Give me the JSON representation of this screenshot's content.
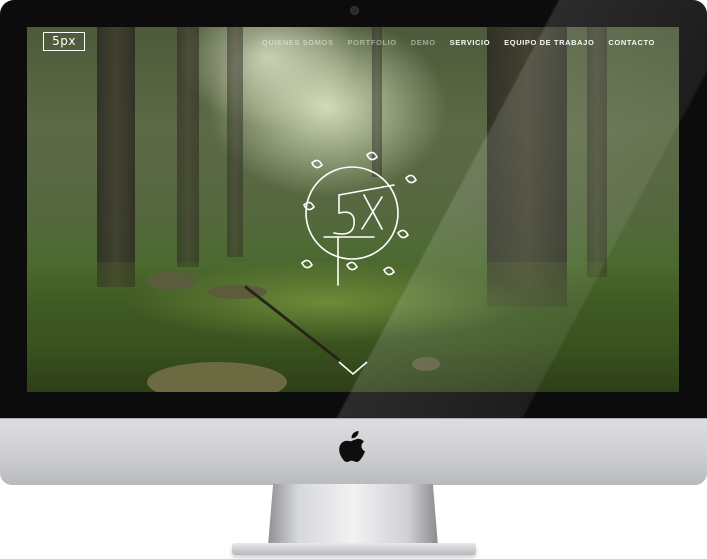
{
  "site": {
    "logo_text": "5px",
    "nav": [
      {
        "label": "Quienes Somos"
      },
      {
        "label": "Portfolio"
      },
      {
        "label": "Demo"
      },
      {
        "label": "Servicio"
      },
      {
        "label": "Equipo de Trabajo"
      },
      {
        "label": "Contacto"
      }
    ],
    "emblem_text": "5X"
  },
  "device": {
    "brand_icon": "apple-icon"
  },
  "colors": {
    "bezel": "#0c0c0c",
    "chin": "#d3d4d7",
    "nav_text": "#ffffff",
    "forest_green": "#4d6a32"
  }
}
